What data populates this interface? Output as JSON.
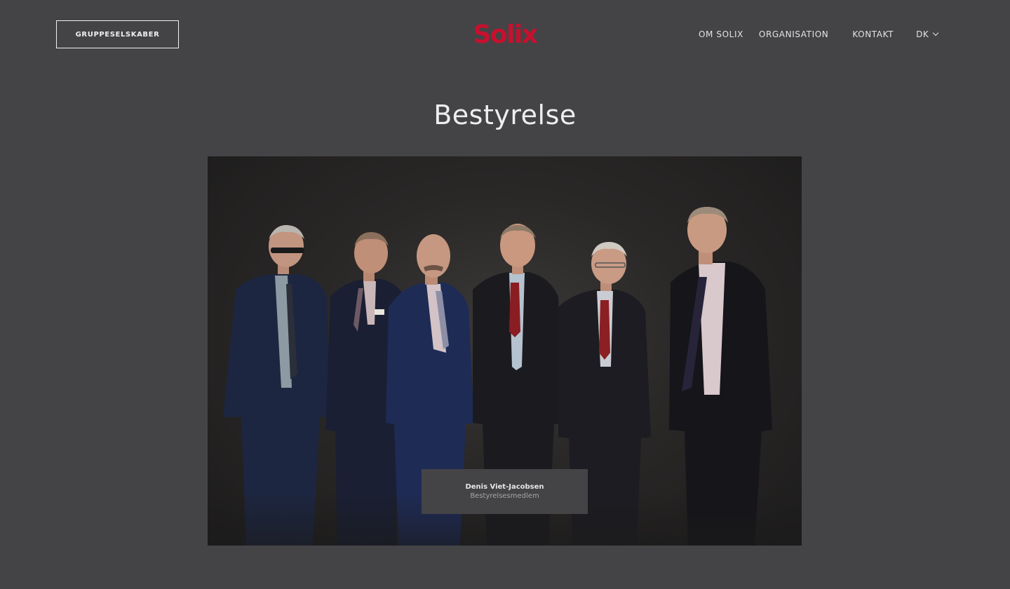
{
  "header": {
    "group_button_label": "GRUPPESELSKABER",
    "logo_text": "Solix",
    "nav": [
      {
        "label": "OM SOLIX"
      },
      {
        "label": "ORGANISATION"
      },
      {
        "label": "KONTAKT"
      }
    ],
    "language": "DK"
  },
  "main": {
    "title": "Bestyrelse",
    "photo": {
      "caption_name": "Denis Viet-Jacobsen",
      "caption_role": "Bestyrelsesmedlem"
    }
  },
  "colors": {
    "page_background": "#444446",
    "brand_red": "#c8102e",
    "photo_background": "#2a2827"
  }
}
